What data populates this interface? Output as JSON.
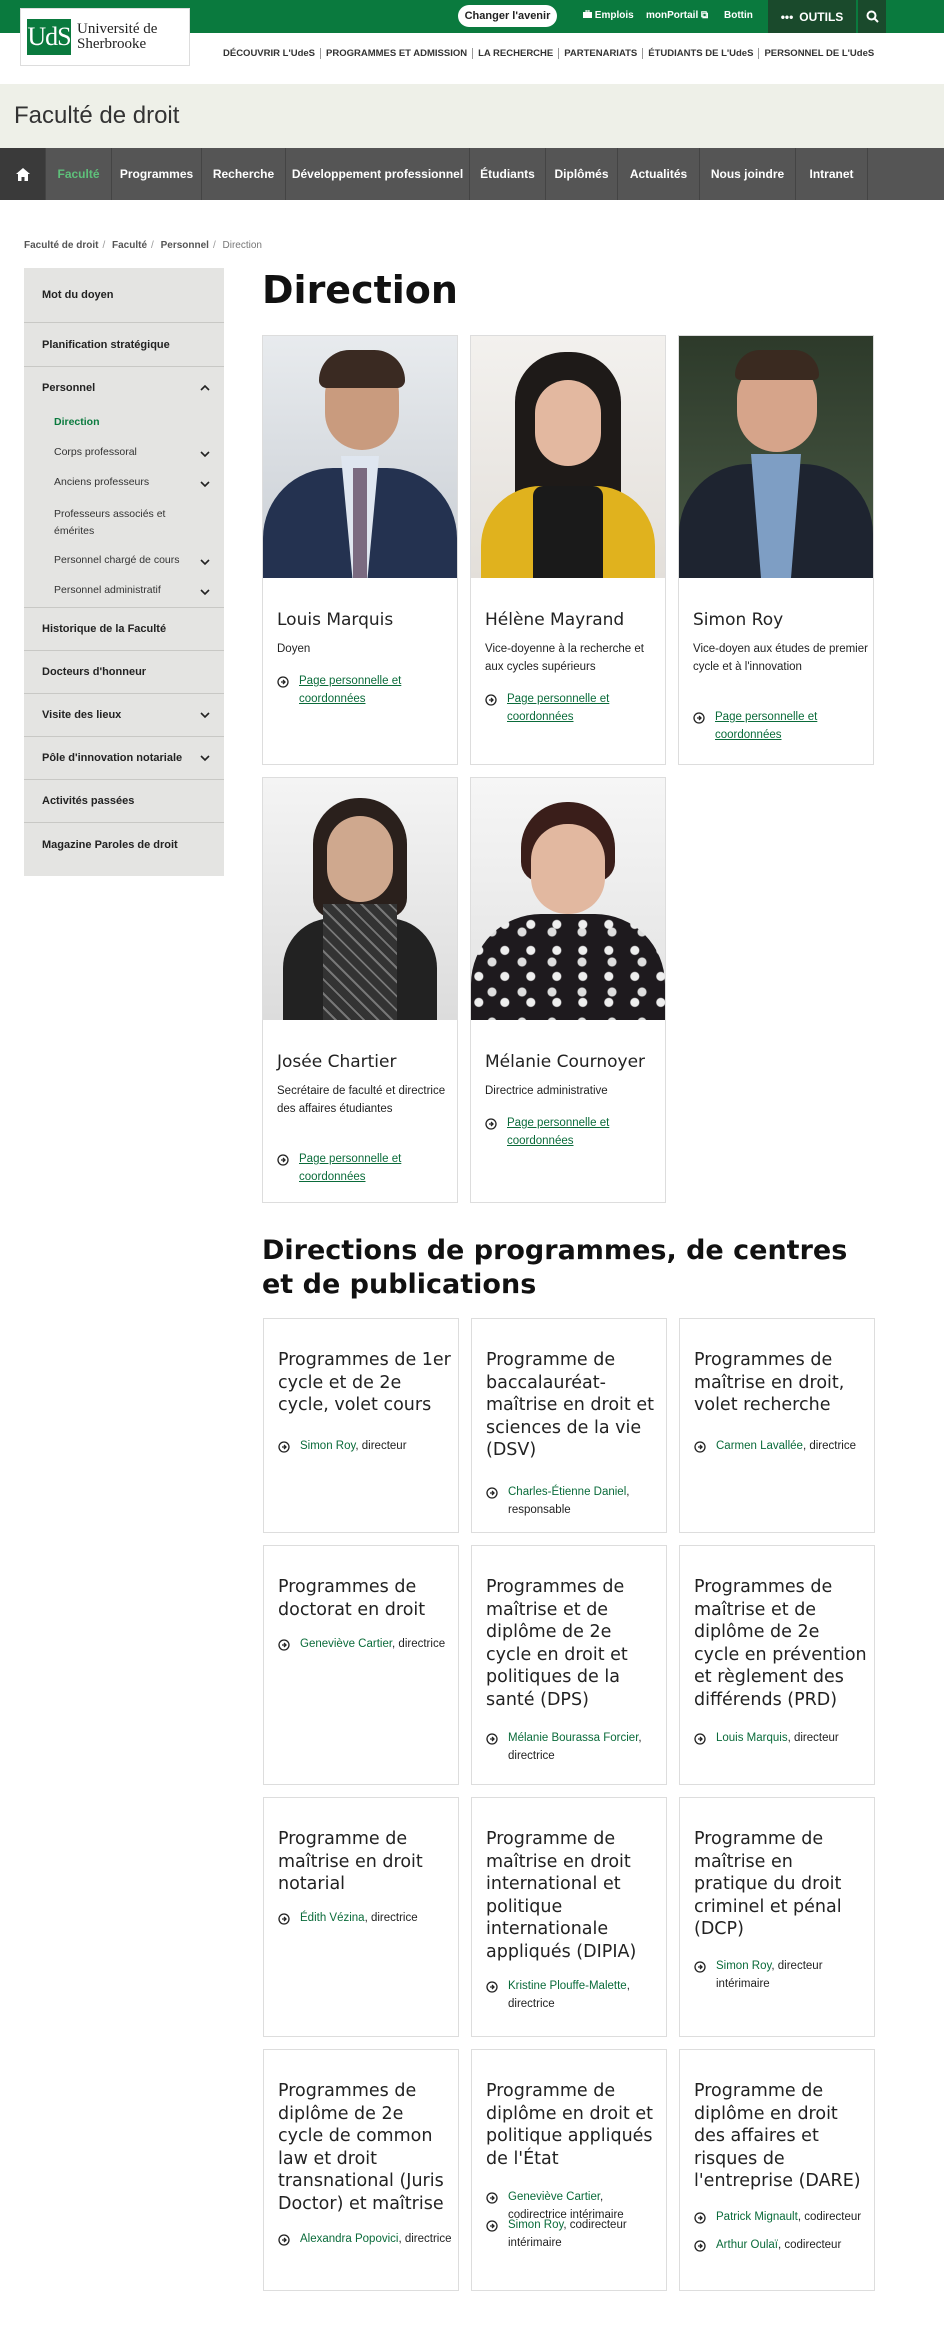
{
  "header": {
    "logo_mark": "UdS",
    "logo_text_1": "Université de",
    "logo_text_2": "Sherbrooke",
    "changer_button": "Changer l'avenir",
    "emplois": "Emplois",
    "monportail": "monPortail",
    "bottin": "Bottin",
    "outils": "OUTILS",
    "nav": [
      "DÉCOUVRIR L'UdeS",
      "PROGRAMMES ET ADMISSION",
      "LA RECHERCHE",
      "PARTENARIATS",
      "ÉTUDIANTS DE L'UdeS",
      "PERSONNEL DE L'UdeS"
    ]
  },
  "faculty": {
    "title": "Faculté de droit"
  },
  "topnav": [
    "Faculté",
    "Programmes",
    "Recherche",
    "Développement professionnel",
    "Étudiants",
    "Diplômés",
    "Actualités",
    "Nous joindre",
    "Intranet"
  ],
  "breadcrumb": [
    "Faculté de droit",
    "Faculté",
    "Personnel",
    "Direction"
  ],
  "sidebar": {
    "items": [
      "Mot du doyen",
      "Planification stratégique",
      "Personnel",
      "Historique de la Faculté",
      "Docteurs d'honneur",
      "Visite des lieux",
      "Pôle d'innovation notariale",
      "Activités passées",
      "Magazine Paroles de droit"
    ],
    "subitems": [
      "Direction",
      "Corps professoral",
      "Anciens professeurs",
      "Professeurs associés et émérites",
      "Personnel chargé de cours",
      "Personnel administratif"
    ]
  },
  "page": {
    "title": "Direction",
    "subtitle": "Directions de programmes, de centres et de publications"
  },
  "people": [
    {
      "name": "Louis Marquis",
      "role": "Doyen",
      "link": "Page personnelle et coordonnées"
    },
    {
      "name": "Hélène Mayrand",
      "role": "Vice-doyenne à la recherche et aux cycles supérieurs",
      "link": "Page personnelle et coordonnées"
    },
    {
      "name": "Simon Roy",
      "role": "Vice-doyen aux études de premier cycle et à l'innovation",
      "link": "Page personnelle et coordonnées"
    },
    {
      "name": "Josée Chartier",
      "role": "Secrétaire de faculté et directrice des affaires étudiantes",
      "link": "Page personnelle et coordonnées"
    },
    {
      "name": "Mélanie Cournoyer",
      "role": "Directrice administrative",
      "link": "Page personnelle et coordonnées"
    }
  ],
  "programs": [
    {
      "title": "Programmes de 1er cycle et de 2e cycle, volet cours",
      "contacts": [
        {
          "name": "Simon Roy",
          "role": ", directeur"
        }
      ]
    },
    {
      "title": "Programme de baccalauréat-maîtrise en droit et sciences de la vie (DSV)",
      "contacts": [
        {
          "name": "Charles-Étienne Daniel",
          "role": ", responsable"
        }
      ]
    },
    {
      "title": "Programmes de maîtrise en droit, volet recherche",
      "contacts": [
        {
          "name": "Carmen Lavallée",
          "role": ", directrice"
        }
      ]
    },
    {
      "title": "Programmes de doctorat en droit",
      "contacts": [
        {
          "name": "Geneviève Cartier",
          "role": ", directrice"
        }
      ]
    },
    {
      "title": "Programmes de maîtrise et de diplôme de 2e cycle en droit et politiques de la santé (DPS)",
      "contacts": [
        {
          "name": "Mélanie Bourassa Forcier",
          "role": ", directrice"
        }
      ]
    },
    {
      "title": "Programmes de maîtrise et de diplôme de 2e cycle en prévention et règlement des différends (PRD)",
      "contacts": [
        {
          "name": "Louis Marquis",
          "role": ", directeur"
        }
      ]
    },
    {
      "title": "Programme de maîtrise en droit notarial",
      "contacts": [
        {
          "name": "Édith Vézina",
          "role": ", directrice"
        }
      ]
    },
    {
      "title": "Programme de maîtrise en droit international et politique internationale appliqués (DIPIA)",
      "contacts": [
        {
          "name": "Kristine Plouffe-Malette",
          "role": ", directrice"
        }
      ]
    },
    {
      "title": "Programme de maîtrise en pratique du droit criminel et pénal (DCP)",
      "contacts": [
        {
          "name": "Simon Roy",
          "role": ", directeur intérimaire"
        }
      ]
    },
    {
      "title": "Programmes de diplôme de 2e cycle de common law et droit transnational (Juris Doctor) et maîtrise",
      "contacts": [
        {
          "name": "Alexandra Popovici",
          "role": ", directrice"
        }
      ]
    },
    {
      "title": "Programme de diplôme en droit et politique appliqués de l'État",
      "contacts": [
        {
          "name": "Geneviève Cartier",
          "role": ", codirectrice intérimaire"
        },
        {
          "name": "Simon Roy",
          "role": ", codirecteur intérimaire"
        }
      ]
    },
    {
      "title": "Programme de diplôme en droit des affaires et risques de l'entreprise (DARE)",
      "contacts": [
        {
          "name": "Patrick Mignault",
          "role": ", codirecteur"
        },
        {
          "name": "Arthur Oulaï",
          "role": ", codirecteur"
        }
      ]
    }
  ]
}
